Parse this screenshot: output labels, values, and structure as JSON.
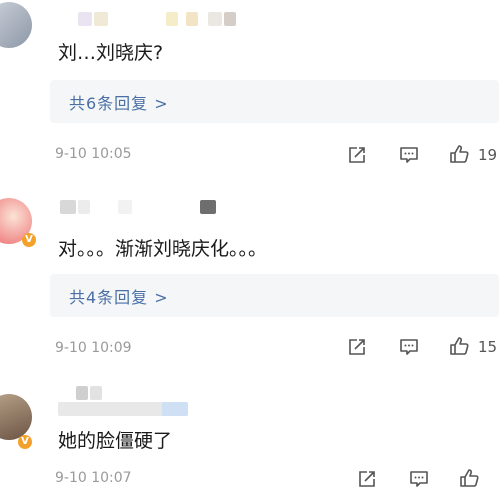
{
  "comments": [
    {
      "text": "刘…刘晓庆?",
      "replies_label": "共6条回复 >",
      "time": "9-10 10:05",
      "likes": "19",
      "icons": [
        "share-icon",
        "comment-icon",
        "thumbs-up-icon"
      ]
    },
    {
      "text": "对。。。渐渐刘晓庆化。。。",
      "replies_label": "共4条回复 >",
      "time": "9-10 10:09",
      "likes": "15",
      "icons": [
        "share-icon",
        "comment-icon",
        "thumbs-up-icon"
      ]
    },
    {
      "text": "她的脸僵硬了",
      "time": "9-10 10:07",
      "likes": "",
      "icons": [
        "share-icon",
        "comment-icon",
        "thumbs-up-icon"
      ]
    }
  ],
  "badge": "V",
  "colors": {
    "link": "#4a6fa5",
    "meta": "#9a9a9a",
    "reply_bg": "#f5f6f8"
  }
}
